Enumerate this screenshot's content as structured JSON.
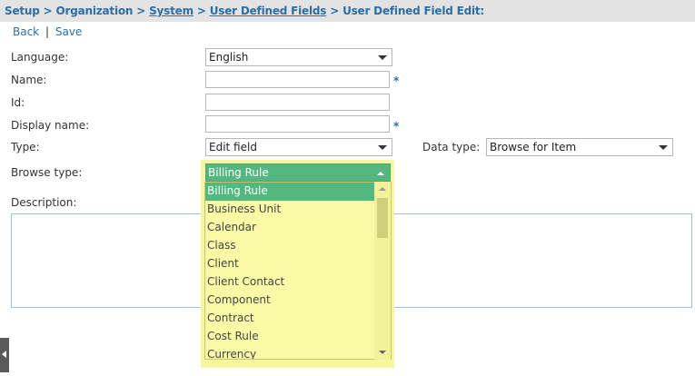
{
  "breadcrumb": {
    "setup": "Setup",
    "organization": "Organization",
    "system": "System",
    "udf": "User Defined Fields",
    "current": "User Defined Field Edit:",
    "sep": ">"
  },
  "actions": {
    "back": "Back",
    "sep": "|",
    "save": "Save"
  },
  "form": {
    "language_label": "Language:",
    "language_value": "English",
    "name_label": "Name:",
    "name_value": "",
    "id_label": "Id:",
    "id_value": "",
    "display_name_label": "Display name:",
    "display_name_value": "",
    "type_label": "Type:",
    "type_value": "Edit field",
    "data_type_label": "Data type:",
    "data_type_value": "Browse for Item",
    "browse_type_label": "Browse type:",
    "browse_type_value": "Billing Rule",
    "description_label": "Description:",
    "required_marker": "*"
  },
  "dropdown": {
    "items": [
      "Billing Rule",
      "Business Unit",
      "Calendar",
      "Class",
      "Client",
      "Client Contact",
      "Component",
      "Contract",
      "Cost Rule",
      "Currency"
    ],
    "selected_index": 0
  },
  "colors": {
    "link": "#2a6fa8",
    "selected": "#53b880",
    "dropdown_bg": "#fafaa6"
  }
}
